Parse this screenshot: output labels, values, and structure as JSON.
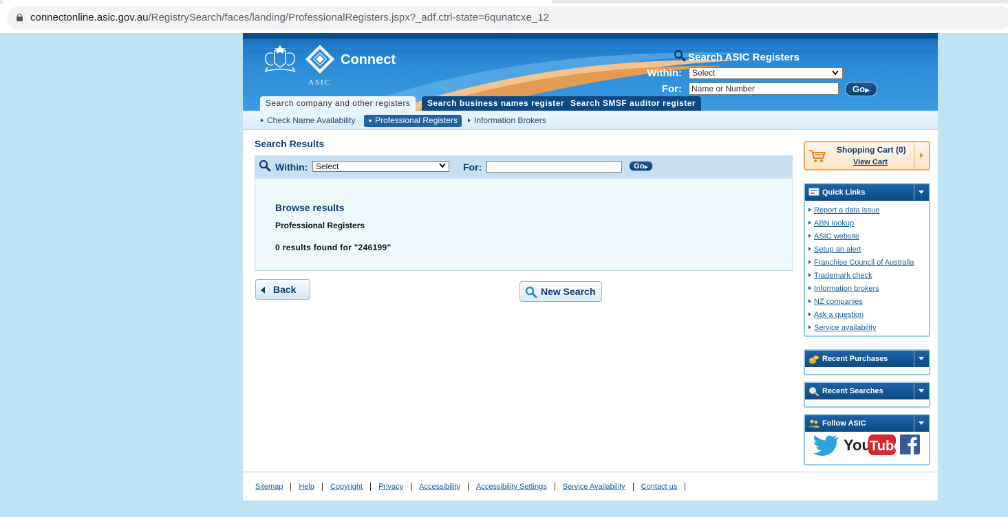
{
  "browser": {
    "url_host": "connectonline.asic.gov.au",
    "url_path": "/RegistrySearch/faces/landing/ProfessionalRegisters.jspx?_adf.ctrl-state=6qunatcxe_12"
  },
  "header": {
    "asic_text": "ASIC",
    "brand": "Connect",
    "search": {
      "title": "Search ASIC Registers",
      "within_label": "Within:",
      "within_value": "Select",
      "for_label": "For:",
      "for_placeholder": "Name or Number",
      "go_label": "Go"
    },
    "tabs": [
      {
        "label": "Search company and other registers"
      },
      {
        "label": "Search business names register"
      },
      {
        "label": "Search SMSF auditor register"
      }
    ]
  },
  "subnav": [
    {
      "label": "Check Name Availability"
    },
    {
      "label": "Professional Registers"
    },
    {
      "label": "Information Brokers"
    }
  ],
  "main": {
    "title": "Search Results",
    "search": {
      "within_label": "Within:",
      "within_value": "Select",
      "for_label": "For:",
      "go_label": "Go"
    },
    "results": {
      "title": "Browse results",
      "subtitle": "Professional Registers",
      "count_text": "0 results found for \"246199\""
    },
    "back_label": "Back",
    "new_search_label": "New Search"
  },
  "sidebar": {
    "cart": {
      "title": "Shopping Cart (0)",
      "link": "View Cart"
    },
    "quick_links": {
      "title": "Quick Links",
      "items": [
        "Report a data issue",
        "ABN lookup",
        "ASIC website",
        "Setup an alert",
        "Franchise Council of Australia",
        "Trademark check",
        "Information brokers",
        "NZ companies",
        "Ask a question",
        "Service availability"
      ]
    },
    "recent_purchases": {
      "title": "Recent Purchases"
    },
    "recent_searches": {
      "title": "Recent Searches"
    },
    "follow": {
      "title": "Follow ASIC",
      "youtube_text_a": "You",
      "youtube_text_b": "Tube"
    }
  },
  "footer": {
    "links": [
      "Sitemap",
      "Help",
      "Copyright",
      "Privacy",
      "Accessibility",
      "Accessibility Settings",
      "Service Availability",
      "Contact us"
    ]
  },
  "colors": {
    "page_background": "#bfe3f3",
    "header_blue": "#2b8ad6",
    "navy": "#0d4a85",
    "cart_orange": "#f3a95b"
  }
}
